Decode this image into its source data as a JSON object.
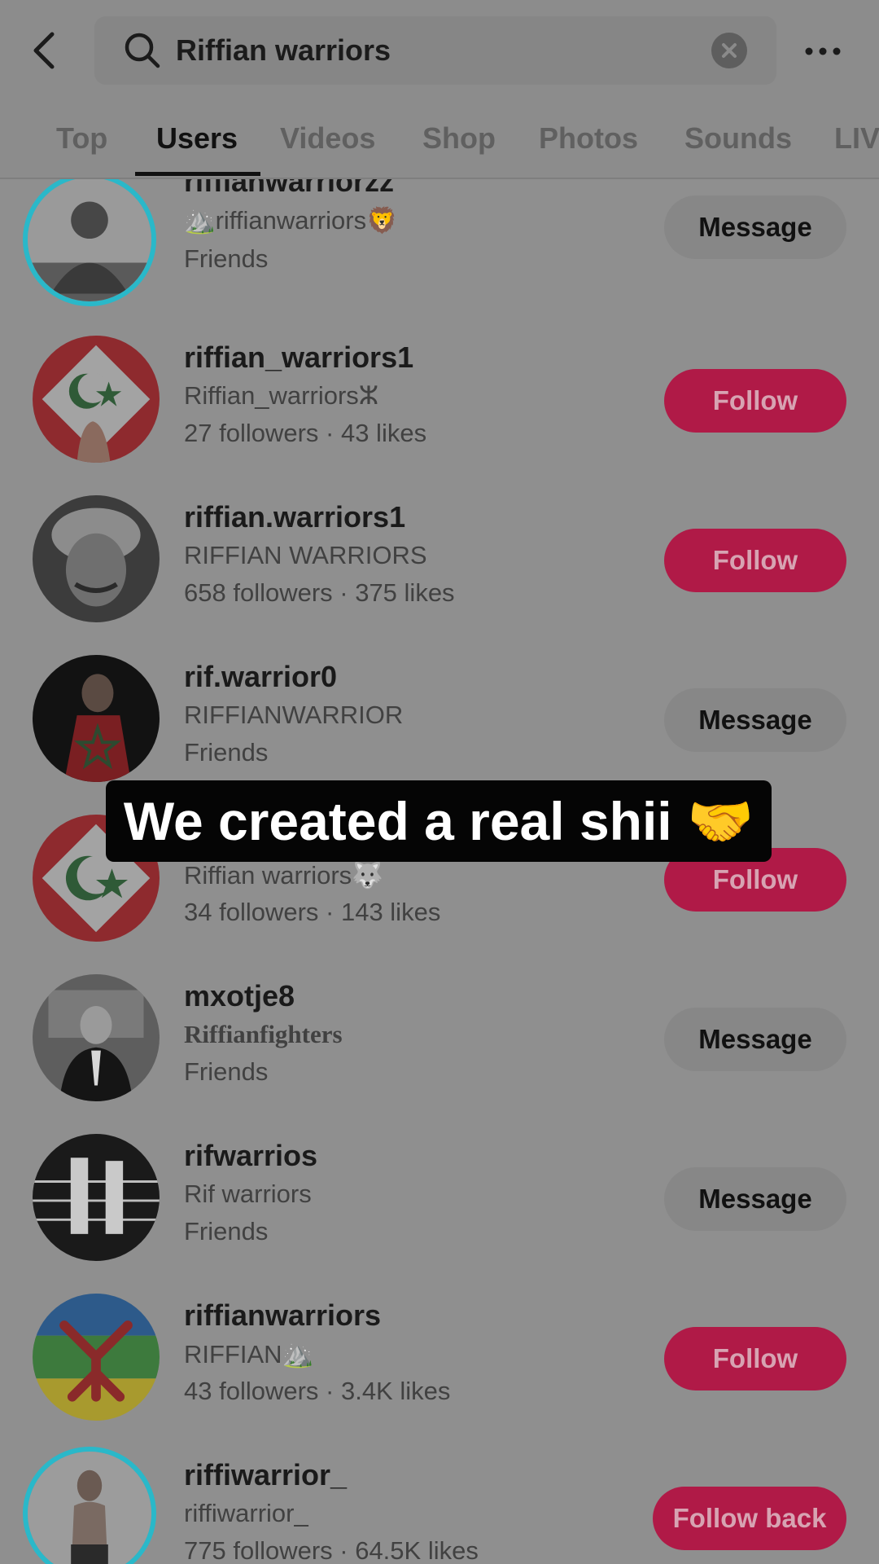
{
  "search": {
    "query": "Riffian warriors",
    "icons": {
      "back": "chevron-left-icon",
      "search": "search-icon",
      "clear": "clear-icon",
      "more": "more-horizontal-icon"
    }
  },
  "tabs": [
    {
      "label": "Top",
      "active": false
    },
    {
      "label": "Users",
      "active": true
    },
    {
      "label": "Videos",
      "active": false
    },
    {
      "label": "Shop",
      "active": false
    },
    {
      "label": "Photos",
      "active": false
    },
    {
      "label": "Sounds",
      "active": false
    },
    {
      "label": "LIV",
      "active": false
    }
  ],
  "users": [
    {
      "username": "riffianwarriorzz",
      "nickname": "⛰️riffianwarriors🦁",
      "meta": "Friends",
      "action": "Message"
    },
    {
      "username": "riffian_warriors1",
      "nickname": "Riffian_warriorsⵣ",
      "meta": "27 followers · 43 likes",
      "action": "Follow"
    },
    {
      "username": "riffian.warriors1",
      "nickname": "RIFFIAN WARRIORS",
      "meta": "658 followers · 375 likes",
      "action": "Follow"
    },
    {
      "username": "rif.warrior0",
      "nickname": "RIFFIANWARRIOR",
      "meta": "Friends",
      "action": "Message"
    },
    {
      "username": "",
      "nickname": "Riffian warriors🐺",
      "meta": "34 followers · 143 likes",
      "action": "Follow"
    },
    {
      "username": "mxotje8",
      "nickname": "Riffianfighters",
      "meta": "Friends",
      "action": "Message"
    },
    {
      "username": "rifwarrios",
      "nickname": "Rif warriors",
      "meta": "Friends",
      "action": "Message"
    },
    {
      "username": "riffianwarriors",
      "nickname": "RIFFIAN⛰️",
      "meta": "43 followers · 3.4K likes",
      "action": "Follow"
    },
    {
      "username": "riffiwarrior_",
      "nickname": "riffiwarrior_",
      "meta": "775 followers · 64.5K likes",
      "action": "Follow back"
    }
  ],
  "caption": "We created a real shii 🤝",
  "colors": {
    "overlay_gray": "#8f8f8f",
    "follow_button": "#b01a47",
    "avatar_ring": "#2ab8c9"
  }
}
